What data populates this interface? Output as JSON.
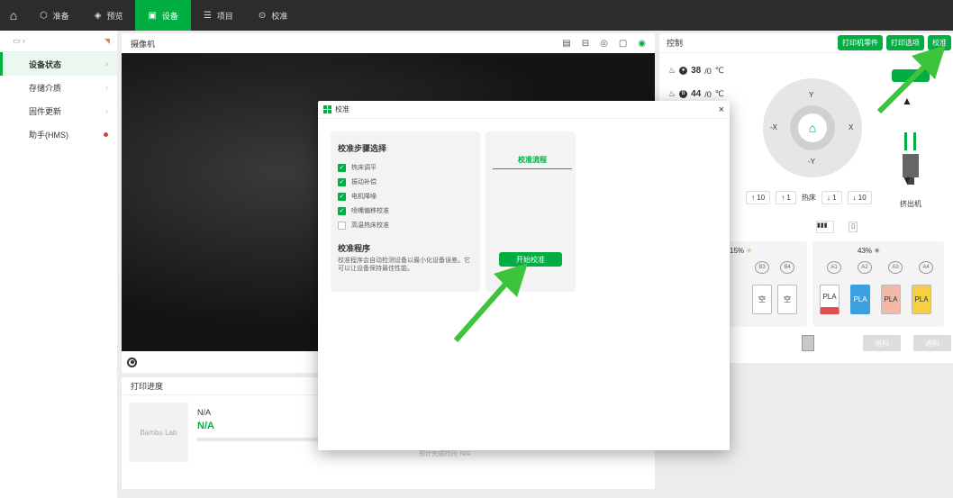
{
  "topbar": {
    "tabs": [
      {
        "label": "准备",
        "icon": "cube-icon",
        "active": false
      },
      {
        "label": "预览",
        "icon": "layers-icon",
        "active": false
      },
      {
        "label": "设备",
        "icon": "device-icon",
        "active": true
      },
      {
        "label": "项目",
        "icon": "project-icon",
        "active": false
      },
      {
        "label": "校准",
        "icon": "calibrate-icon",
        "active": false
      }
    ]
  },
  "sidebar": {
    "items": [
      {
        "label": "设备状态",
        "active": true
      },
      {
        "label": "存储介质",
        "active": false
      },
      {
        "label": "固件更新",
        "active": false
      },
      {
        "label": "助手(HMS)",
        "active": false
      }
    ]
  },
  "camera": {
    "title": "摄像机"
  },
  "progress": {
    "title": "打印进度",
    "thumb_brand": "Bambu Lab",
    "name": "N/A",
    "status": "N/A",
    "finish_time": "预计完成时间: N/A"
  },
  "control": {
    "title": "控制",
    "buttons": [
      "打印机零件",
      "打印选项",
      "校准"
    ],
    "nozzle_temp": "38",
    "nozzle_target": "/0",
    "bed_temp": "44",
    "bed_target": "/0",
    "unit": "℃",
    "joystick": {
      "y_up": "Y",
      "y_down": "-Y",
      "x_left": "-X",
      "x_right": "X",
      "p10": "+10",
      "p1": "+1",
      "m1": "-1",
      "m10": "-10"
    },
    "z_controls": [
      "10",
      "1",
      "热床",
      "1",
      "10"
    ],
    "extruder_label": "挤出机"
  },
  "ams": {
    "left": {
      "humidity": "15",
      "unit": "%",
      "slots": [
        "B3",
        "B4"
      ],
      "materials": [
        "空",
        "空"
      ]
    },
    "right": {
      "humidity": "43",
      "unit": "%",
      "slots": [
        "A1",
        "A2",
        "A3",
        "A4"
      ],
      "materials": [
        "PLA",
        "PLA",
        "PLA",
        "PLA"
      ],
      "colors": [
        "#e05050",
        "#3aa0e0",
        "#f2b8a8",
        "#f5d040"
      ]
    },
    "buttons": [
      "退料",
      "进料"
    ]
  },
  "dialog": {
    "title": "校准",
    "steps_title": "校准步骤选择",
    "steps": [
      {
        "label": "热床调平",
        "checked": true
      },
      {
        "label": "振动补偿",
        "checked": true
      },
      {
        "label": "电机降噪",
        "checked": true
      },
      {
        "label": "喷嘴偏移校准",
        "checked": true
      },
      {
        "label": "高温热床校准",
        "checked": false
      }
    ],
    "program_title": "校准程序",
    "program_desc": "校准程序会自动检测设备以最小化设备误差。它可以让设备保持最佳性能。",
    "flow_title": "校准流程",
    "start_button": "开始校准"
  },
  "colors": {
    "accent": "#00ae42",
    "arrow": "#3cc43c"
  }
}
